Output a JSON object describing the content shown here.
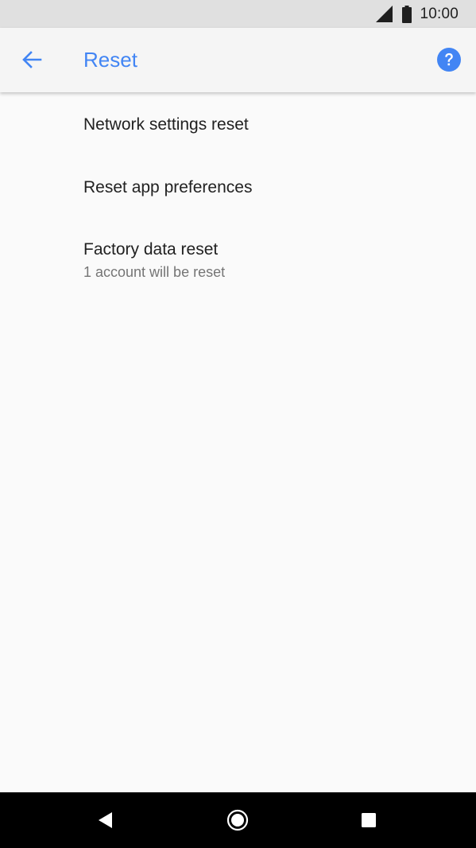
{
  "status_bar": {
    "time": "10:00",
    "icons": [
      "signal-icon",
      "battery-icon"
    ]
  },
  "app_bar": {
    "title": "Reset",
    "back_icon": "arrow-back-icon",
    "help_icon": "help-icon",
    "accent_color": "#4285f4"
  },
  "settings": {
    "items": [
      {
        "title": "Network settings reset"
      },
      {
        "title": "Reset app preferences"
      },
      {
        "title": "Factory data reset",
        "summary": "1 account will be reset"
      }
    ]
  },
  "nav_bar": {
    "icons": [
      "nav-back-icon",
      "nav-home-icon",
      "nav-recents-icon"
    ]
  }
}
